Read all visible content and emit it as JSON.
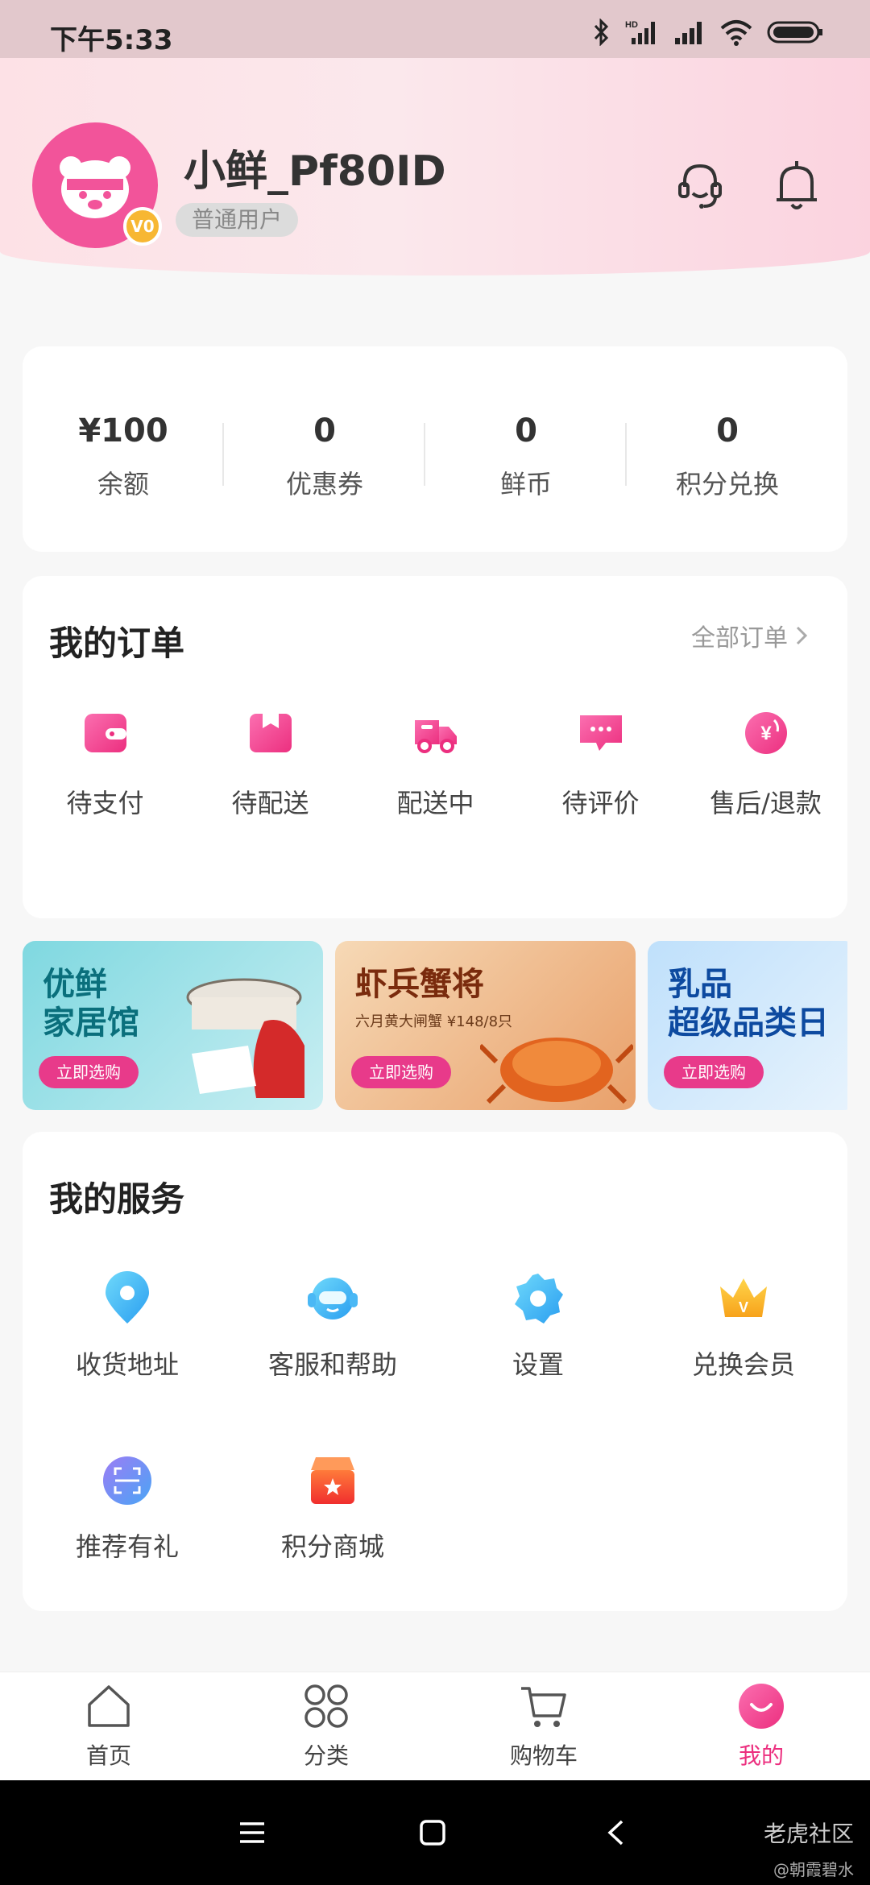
{
  "status_bar": {
    "time": "下午5:33"
  },
  "profile": {
    "username": "小鲜_Pf80ID",
    "user_level": "普通用户",
    "vip_badge": "V0"
  },
  "assets": [
    {
      "value": "¥100",
      "label": "余额"
    },
    {
      "value": "0",
      "label": "优惠券"
    },
    {
      "value": "0",
      "label": "鲜币"
    },
    {
      "value": "0",
      "label": "积分兑换"
    }
  ],
  "orders": {
    "title": "我的订单",
    "all_label": "全部订单",
    "items": [
      {
        "label": "待支付",
        "icon": "wallet-icon"
      },
      {
        "label": "待配送",
        "icon": "package-icon"
      },
      {
        "label": "配送中",
        "icon": "delivery-truck-icon"
      },
      {
        "label": "待评价",
        "icon": "comment-icon"
      },
      {
        "label": "售后/退款",
        "icon": "refund-icon"
      }
    ]
  },
  "banners": [
    {
      "title": "优鲜\n家居馆",
      "subtitle": "",
      "button": "立即选购"
    },
    {
      "title": "虾兵蟹将",
      "subtitle": "六月黄大闸蟹 ¥148/8只",
      "button": "立即选购"
    },
    {
      "title": "乳品\n超级品类日",
      "subtitle": "",
      "button": "立即选购"
    }
  ],
  "services": {
    "title": "我的服务",
    "items": [
      {
        "label": "收货地址",
        "icon": "location-pin-icon"
      },
      {
        "label": "客服和帮助",
        "icon": "customer-service-icon"
      },
      {
        "label": "设置",
        "icon": "settings-gear-icon"
      },
      {
        "label": "兑换会员",
        "icon": "crown-icon"
      },
      {
        "label": "推荐有礼",
        "icon": "scan-icon"
      },
      {
        "label": "积分商城",
        "icon": "store-icon"
      }
    ]
  },
  "tabbar": [
    {
      "label": "首页",
      "icon": "home-icon"
    },
    {
      "label": "分类",
      "icon": "category-grid-icon"
    },
    {
      "label": "购物车",
      "icon": "cart-icon"
    },
    {
      "label": "我的",
      "icon": "profile-smile-icon",
      "active": true
    }
  ],
  "watermark": {
    "text": "老虎社区",
    "sub": "@朝霞碧水"
  },
  "colors": {
    "accent": "#f0479a",
    "page_bg": "#f7f7f7"
  }
}
